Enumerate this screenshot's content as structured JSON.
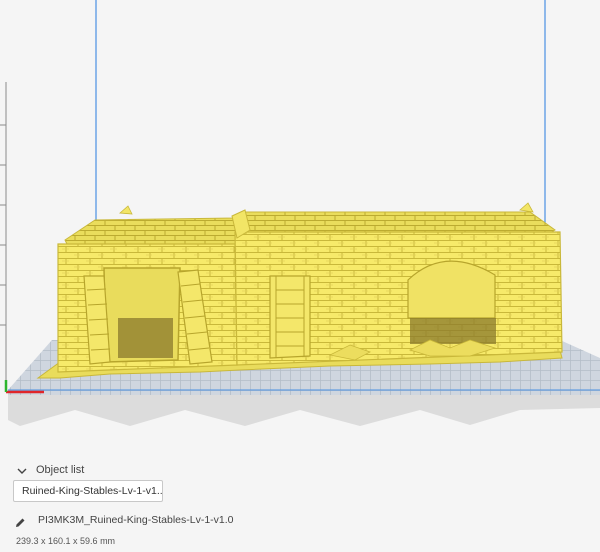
{
  "object_list": {
    "header_label": "Object list",
    "selected_object": "Ruined-King-Stables-Lv-1-v1..."
  },
  "job": {
    "name": "PI3MK3M_Ruined-King-Stables-Lv-1-v1.0",
    "dimensions": "239.3 x 160.1 x 59.6 mm"
  },
  "colors": {
    "model": "#f7ea6a",
    "model_shadow": "#c9b83a",
    "build_volume_line": "#4a90e2",
    "axis_x": "#e0262a",
    "axis_y": "#2db52d"
  },
  "icons": {
    "collapse": "chevron-down-icon",
    "edit": "pencil-icon"
  }
}
